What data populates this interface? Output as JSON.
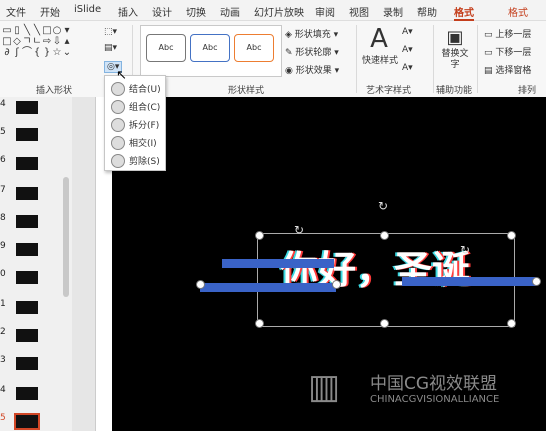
{
  "menu": [
    "文件",
    "开始",
    "iSlide",
    "插入",
    "设计",
    "切换",
    "动画",
    "幻灯片放映",
    "审阅",
    "视图",
    "录制",
    "帮助",
    "格式",
    "格式"
  ],
  "ribbon": {
    "insert_shapes_label": "插入形状",
    "shape_styles_label": "形状样式",
    "art_styles_label": "艺术字样式",
    "aux_label": "辅助功能",
    "arrange_label": "排列",
    "style_sample": "Abc",
    "fill": "形状填充",
    "outline": "形状轮廓",
    "effect": "形状效果",
    "quick_styles": "快速样式",
    "alt_text": "替换文字",
    "bring_forward": "上移一层",
    "send_backward": "下移一层",
    "selection_pane": "选择窗格"
  },
  "merge_menu": [
    "结合(U)",
    "组合(C)",
    "拆分(F)",
    "相交(I)",
    "剪除(S)"
  ],
  "slide_numbers": [
    "4",
    "5",
    "6",
    "7",
    "8",
    "9",
    "0",
    "1",
    "2",
    "3",
    "4",
    "5"
  ],
  "slide_text": "你好，圣诞",
  "watermark": {
    "cn": "中国CG视效联盟",
    "en": "CHINACGVISIONALLIANCE"
  },
  "colors": {
    "accent": "#c43e1c",
    "bar": "#3a63c7"
  }
}
